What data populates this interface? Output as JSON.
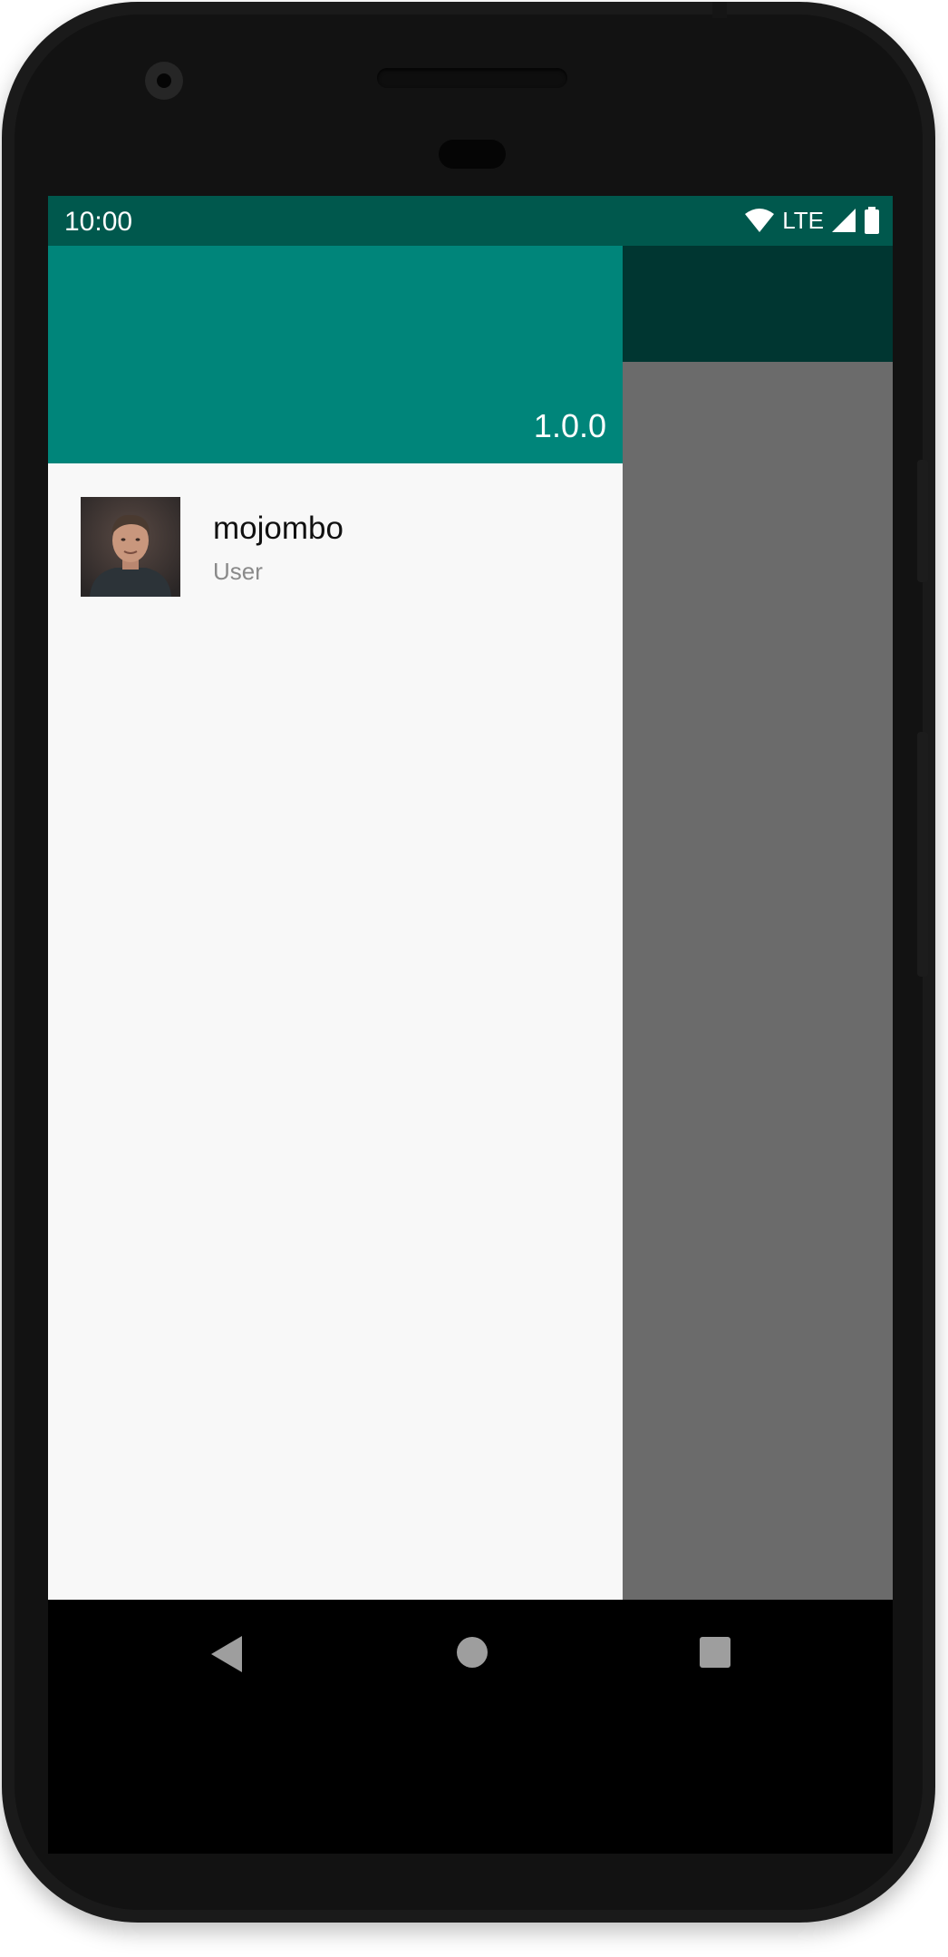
{
  "status_bar": {
    "time": "10:00",
    "network": "LTE",
    "icons": [
      "wifi-icon",
      "signal-icon",
      "battery-icon"
    ]
  },
  "drawer": {
    "header": {
      "version": "1.0.0"
    },
    "user": {
      "name": "mojombo",
      "role": "User",
      "avatar": "avatar-photo"
    }
  },
  "navigation_bar": {
    "buttons": [
      "back-icon",
      "home-icon",
      "recents-icon"
    ]
  },
  "colors": {
    "status_bar": "#00584d",
    "drawer_header": "#00857a",
    "scrim": "#6b6b6b",
    "dimmed_appbar": "#003631",
    "drawer_bg": "#f8f8f8"
  }
}
